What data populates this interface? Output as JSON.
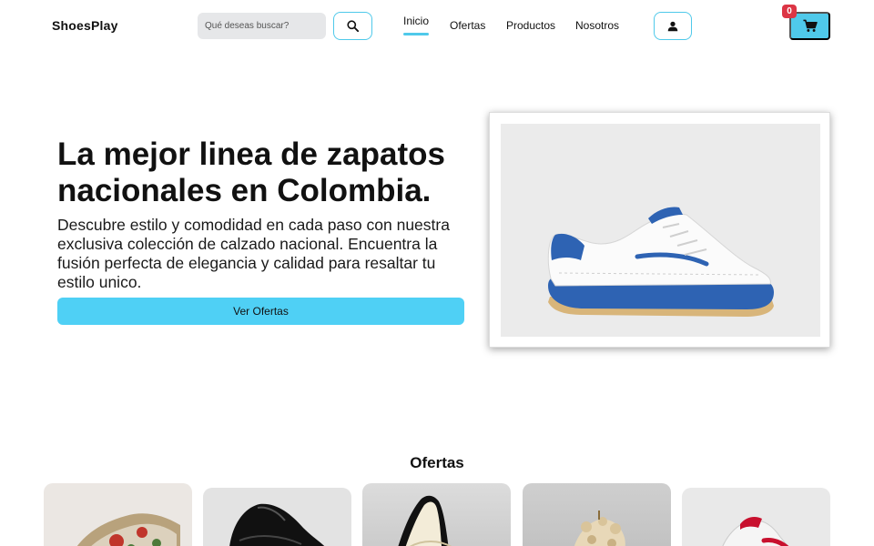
{
  "header": {
    "logo": "ShoesPlay",
    "search_placeholder": "Qué deseas buscar?",
    "search_icon": "search-icon",
    "nav": [
      "Inicio",
      "Ofertas",
      "Productos",
      "Nosotros"
    ],
    "active_nav": "Inicio",
    "user_icon": "user-icon",
    "cart_icon": "cart-icon",
    "cart_count": "0"
  },
  "hero": {
    "title": "La mejor linea de zapatos nacionales en Colombia.",
    "description": "Descubre estilo y comodidad en cada paso con nuestra exclusiva colección de calzado nacional. Encuentra la fusión perfecta de elegancia y calidad para resaltar tu estilo unico.",
    "button_label": "Ver Ofertas"
  },
  "offers": {
    "title": "Ofertas"
  },
  "colors": {
    "accent": "#4fc9ea",
    "badge": "#dc3545"
  }
}
